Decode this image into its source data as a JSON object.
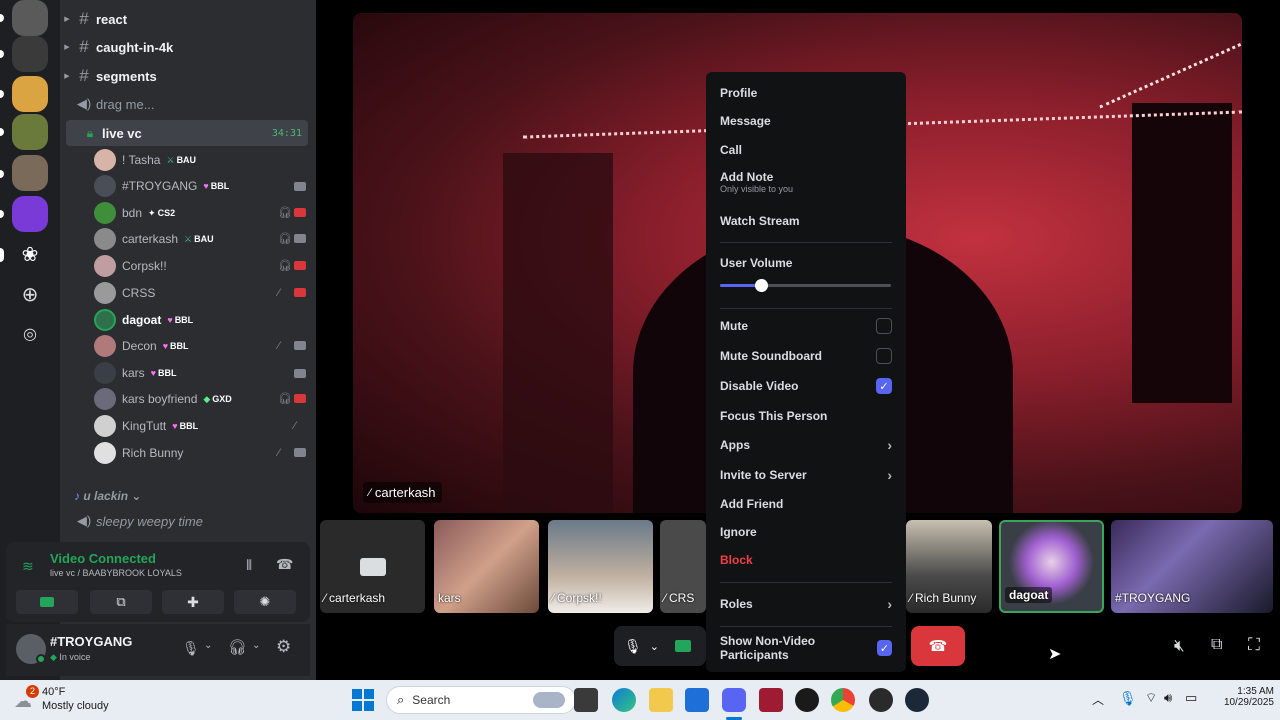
{
  "sidebar": {
    "channels": [
      {
        "name": "react"
      },
      {
        "name": "caught-in-4k"
      },
      {
        "name": "segments"
      },
      {
        "name": "drag me..."
      },
      {
        "name": "live vc",
        "timer": "34:31"
      }
    ],
    "voice_users": [
      {
        "name": "! Tasha",
        "tag": "BAU",
        "tag_color": "#43b581"
      },
      {
        "name": "#TROYGANG",
        "tag": "BBL",
        "tag_color": "#ff73fa"
      },
      {
        "name": "bdn",
        "tag": "CS2",
        "tag_color": "#ffffff"
      },
      {
        "name": "carterkash",
        "tag": "BAU",
        "tag_color": "#43b581"
      },
      {
        "name": "Corpsk!!",
        "tag": ""
      },
      {
        "name": "CRSS",
        "tag": ""
      },
      {
        "name": "dagoat",
        "tag": "BBL",
        "tag_color": "#ff73fa"
      },
      {
        "name": "Decon",
        "tag": "BBL",
        "tag_color": "#ff73fa"
      },
      {
        "name": "kars",
        "tag": "BBL",
        "tag_color": "#ff73fa"
      },
      {
        "name": "kars boyfriend",
        "tag": "GXD",
        "tag_color": "#57f287"
      },
      {
        "name": "KingTutt",
        "tag": "BBL",
        "tag_color": "#ff73fa"
      },
      {
        "name": "Rich Bunny",
        "tag": ""
      }
    ],
    "lower_channels": [
      {
        "name": "u lackin"
      },
      {
        "name": "sleepy weepy time"
      }
    ]
  },
  "voice_panel": {
    "status": "Video Connected",
    "location": "live vc / BAABYBROOK LOYALS"
  },
  "user_panel": {
    "username": "#TROYGANG",
    "status": "In voice"
  },
  "stage": {
    "main_label": "carterkash",
    "thumbnails": [
      "carterkash",
      "kars",
      "Corpsk!!",
      "CRS",
      "Rich Bunny",
      "dagoat",
      "#TROYGANG"
    ]
  },
  "menu": {
    "profile": "Profile",
    "message": "Message",
    "call": "Call",
    "add_note": "Add Note",
    "add_note_sub": "Only visible to you",
    "watch_stream": "Watch Stream",
    "user_volume": "User Volume",
    "volume_level": 0.24,
    "mute": "Mute",
    "mute_soundboard": "Mute Soundboard",
    "disable_video": "Disable Video",
    "focus": "Focus This Person",
    "apps": "Apps",
    "invite": "Invite to Server",
    "add_friend": "Add Friend",
    "ignore": "Ignore",
    "block": "Block",
    "roles": "Roles",
    "show_non_video": "Show Non-Video Participants"
  },
  "taskbar": {
    "weather_temp": "40°F",
    "weather_desc": "Mostly cloudy",
    "weather_badge": "2",
    "search_placeholder": "Search",
    "time": "1:35 AM",
    "date": "10/29/2025"
  },
  "colors": {
    "accent": "#5865f2",
    "danger": "#da373c",
    "online": "#23a55a"
  }
}
